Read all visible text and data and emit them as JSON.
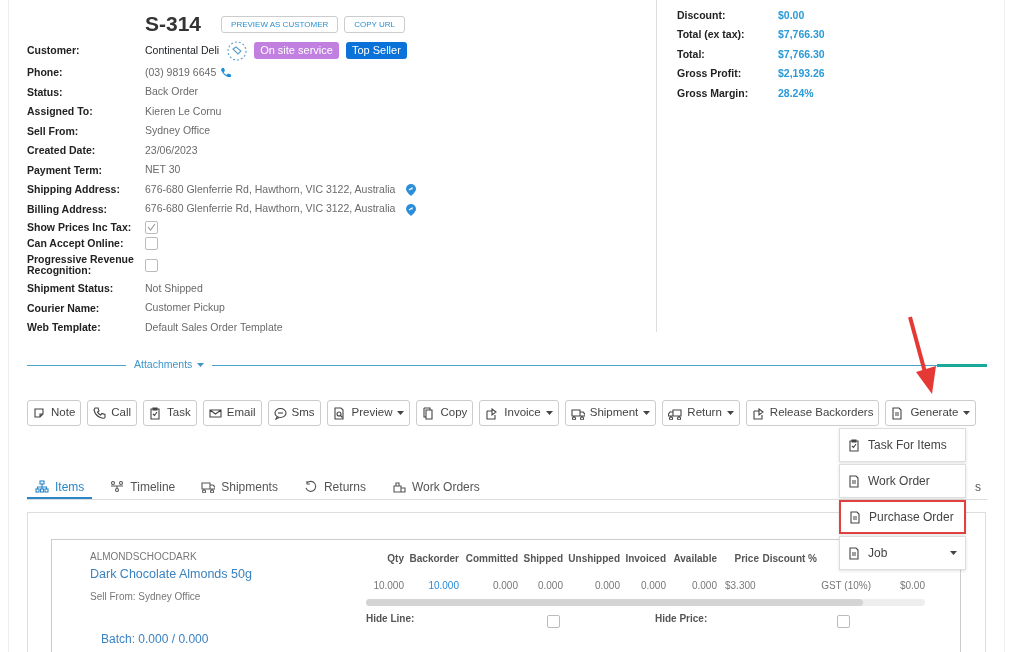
{
  "order": {
    "number": "S-314",
    "header_buttons": [
      "PREVIEW AS CUSTOMER",
      "COPY URL"
    ],
    "fields": [
      {
        "kind": "customer",
        "label": "Customer:",
        "value": "Continental Deli",
        "tags": [
          {
            "text": "On site service",
            "color": "#c17fe0"
          },
          {
            "text": "Top Seller",
            "color": "#0b72d9"
          }
        ]
      },
      {
        "kind": "phone",
        "label": "Phone:",
        "value": "(03) 9819 6645"
      },
      {
        "kind": "text",
        "label": "Status:",
        "value": "Back Order"
      },
      {
        "kind": "text",
        "label": "Assigned To:",
        "value": "Kieren Le Cornu"
      },
      {
        "kind": "text",
        "label": "Sell From:",
        "value": "Sydney Office"
      },
      {
        "kind": "text",
        "label": "Created Date:",
        "value": "23/06/2023"
      },
      {
        "kind": "text",
        "label": "Payment Term:",
        "value": "NET 30"
      },
      {
        "kind": "address",
        "label": "Shipping Address:",
        "value": "676-680 Glenferrie Rd, Hawthorn, VIC 3122, Australia"
      },
      {
        "kind": "address",
        "label": "Billing Address:",
        "value": "676-680 Glenferrie Rd, Hawthorn, VIC 3122, Australia"
      },
      {
        "kind": "checkbox",
        "label": "Show Prices Inc Tax:",
        "checked": true
      },
      {
        "kind": "checkbox",
        "label": "Can Accept Online:",
        "checked": false
      },
      {
        "kind": "checkbox",
        "label": "Progressive Revenue Recognition:",
        "checked": false
      },
      {
        "kind": "text",
        "label": "Shipment Status:",
        "value": "Not Shipped"
      },
      {
        "kind": "text",
        "label": "Courier Name:",
        "value": "Customer Pickup"
      },
      {
        "kind": "text",
        "label": "Web Template:",
        "value": "Default Sales Order Template"
      }
    ]
  },
  "summary": [
    {
      "label": "Discount:",
      "value": "$0.00"
    },
    {
      "label": "Total (ex tax):",
      "value": "$7,766.30"
    },
    {
      "label": "Total:",
      "value": "$7,766.30"
    },
    {
      "label": "Gross Profit:",
      "value": "$2,193.26"
    },
    {
      "label": "Gross Margin:",
      "value": "28.24%"
    }
  ],
  "attachments": {
    "label": "Attachments"
  },
  "toolbar": [
    {
      "label": "Note",
      "dropdown": false
    },
    {
      "label": "Call",
      "dropdown": false
    },
    {
      "label": "Task",
      "dropdown": false
    },
    {
      "label": "Email",
      "dropdown": false
    },
    {
      "label": "Sms",
      "dropdown": false
    },
    {
      "label": "Preview",
      "dropdown": true
    },
    {
      "label": "Copy",
      "dropdown": false
    },
    {
      "label": "Invoice",
      "dropdown": true
    },
    {
      "label": "Shipment",
      "dropdown": true
    },
    {
      "label": "Return",
      "dropdown": true
    },
    {
      "label": "Release Backorders",
      "dropdown": false
    },
    {
      "label": "Generate",
      "dropdown": true
    }
  ],
  "generate_menu": [
    {
      "label": "Task For Items",
      "highlighted": false,
      "dropdown": false
    },
    {
      "label": "Work Order",
      "highlighted": false,
      "dropdown": false
    },
    {
      "label": "Purchase Order",
      "highlighted": true,
      "dropdown": false
    },
    {
      "label": "Job",
      "highlighted": false,
      "dropdown": true
    }
  ],
  "tabs": [
    {
      "label": "Items",
      "selected": true
    },
    {
      "label": "Timeline",
      "selected": false
    },
    {
      "label": "Shipments",
      "selected": false
    },
    {
      "label": "Returns",
      "selected": false
    },
    {
      "label": "Work Orders",
      "selected": false
    },
    {
      "label": "s",
      "selected": false
    }
  ],
  "line_item": {
    "sku": "ALMONDSCHOCDARK",
    "name": "Dark Chocolate Almonds 50g",
    "sell_from": "Sell From: Sydney Office",
    "batch": "Batch: 0.000 / 0.000",
    "columns": [
      "Qty",
      "Backorder",
      "Committed",
      "Shipped",
      "Unshipped",
      "Invoiced",
      "Available",
      "Price",
      "Discount %"
    ],
    "values": [
      {
        "text": "10.000",
        "link": false
      },
      {
        "text": "10.000",
        "link": true
      },
      {
        "text": "0.000",
        "link": false
      },
      {
        "text": "0.000",
        "link": false
      },
      {
        "text": "0.000",
        "link": false
      },
      {
        "text": "0.000",
        "link": false
      },
      {
        "text": "0.000",
        "link": false
      },
      {
        "text": "$3.300",
        "link": false
      }
    ],
    "tax": "GST (10%)",
    "amount": "$0.00",
    "hide_line": {
      "label": "Hide Line:",
      "checked": false
    },
    "hide_price": {
      "label": "Hide Price:",
      "checked": false
    }
  },
  "annotation": {
    "arrow": true
  }
}
